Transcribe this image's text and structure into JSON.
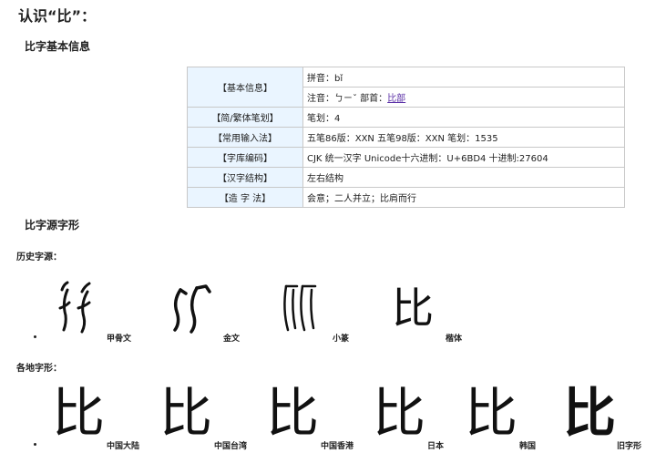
{
  "title": "认识“比”：",
  "section_info": {
    "heading": "比字基本信息"
  },
  "info_table": {
    "basic_label": "【基本信息】",
    "pinyin": "拼音：bǐ",
    "zhuyin_prefix": "注音：ㄅㄧˇ  部首：",
    "radical_link": "比部",
    "rows": [
      {
        "label": "【简/繁体笔划】",
        "value": "笔划：4"
      },
      {
        "label": "【常用输入法】",
        "value": "五笔86版：XXN  五笔98版：XXN  笔划：1535"
      },
      {
        "label": "【字库编码】",
        "value": "CJK 统一汉字 Unicode十六进制：U+6BD4 十进制:27604"
      },
      {
        "label": "【汉字结构】",
        "value": "左右结构"
      },
      {
        "label": "【造 字 法】",
        "value": "会意；二人并立；比肩而行"
      }
    ]
  },
  "section_source": {
    "heading": "比字源字形"
  },
  "history": {
    "label": "历史字源：",
    "items": [
      {
        "caption": "甲骨文"
      },
      {
        "caption": "金文"
      },
      {
        "caption": "小篆"
      },
      {
        "caption": "楷体",
        "glyph": "比"
      }
    ]
  },
  "regional": {
    "label": "各地字形：",
    "items": [
      {
        "caption": "中国大陆",
        "glyph": "比"
      },
      {
        "caption": "中国台湾",
        "glyph": "比"
      },
      {
        "caption": "中国香港",
        "glyph": "比"
      },
      {
        "caption": "日本",
        "glyph": "比"
      },
      {
        "caption": "韩国",
        "glyph": "比"
      },
      {
        "caption": "旧字形",
        "glyph": "比"
      }
    ]
  }
}
